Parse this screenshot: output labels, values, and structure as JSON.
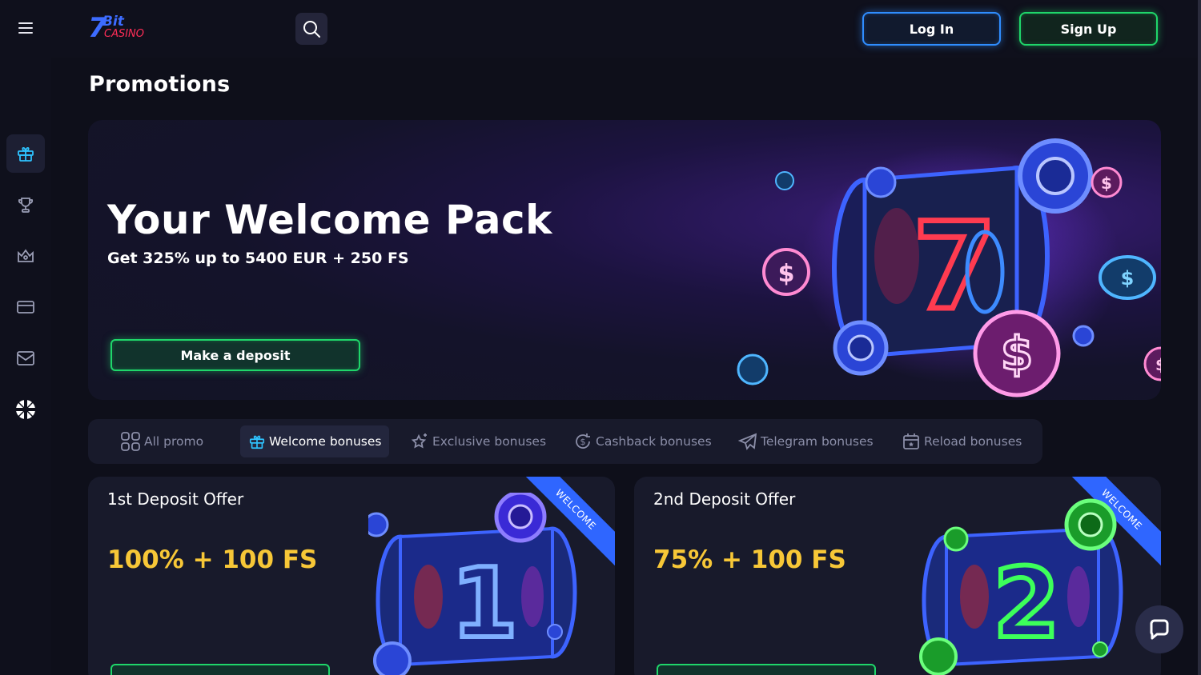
{
  "header": {
    "logo_text": "7Bit CASINO",
    "login_label": "Log In",
    "signup_label": "Sign Up"
  },
  "sidebar": {
    "items": [
      {
        "icon": "gift-icon",
        "active": true
      },
      {
        "icon": "trophy-icon",
        "active": false
      },
      {
        "icon": "crown-icon",
        "active": false
      },
      {
        "icon": "card-icon",
        "active": false
      },
      {
        "icon": "mail-icon",
        "active": false
      },
      {
        "icon": "uk-flag-icon",
        "active": false
      }
    ]
  },
  "page": {
    "title": "Promotions"
  },
  "hero": {
    "title": "Your Welcome Pack",
    "subtitle": "Get 325% up to 5400 EUR + 250 FS",
    "cta_label": "Make a deposit"
  },
  "tabs": [
    {
      "label": "All promo",
      "icon": "grid-icon",
      "active": false
    },
    {
      "label": "Welcome bonuses",
      "icon": "gift-icon",
      "active": true
    },
    {
      "label": "Exclusive bonuses",
      "icon": "star-icon",
      "active": false
    },
    {
      "label": "Cashback bonuses",
      "icon": "cashback-icon",
      "active": false
    },
    {
      "label": "Telegram bonuses",
      "icon": "telegram-icon",
      "active": false
    },
    {
      "label": "Reload bonuses",
      "icon": "calendar-icon",
      "active": false
    }
  ],
  "cards": [
    {
      "title": "1st Deposit Offer",
      "offer": "100% + 100 FS",
      "ribbon": "WELCOME",
      "digit": "1"
    },
    {
      "title": "2nd Deposit Offer",
      "offer": "75% + 100 FS",
      "ribbon": "WELCOME",
      "digit": "2"
    }
  ],
  "colors": {
    "accent_blue": "#2f8dff",
    "accent_green": "#1fd66a",
    "offer_yellow": "#f7c737",
    "ribbon_blue": "#2f66ff"
  }
}
